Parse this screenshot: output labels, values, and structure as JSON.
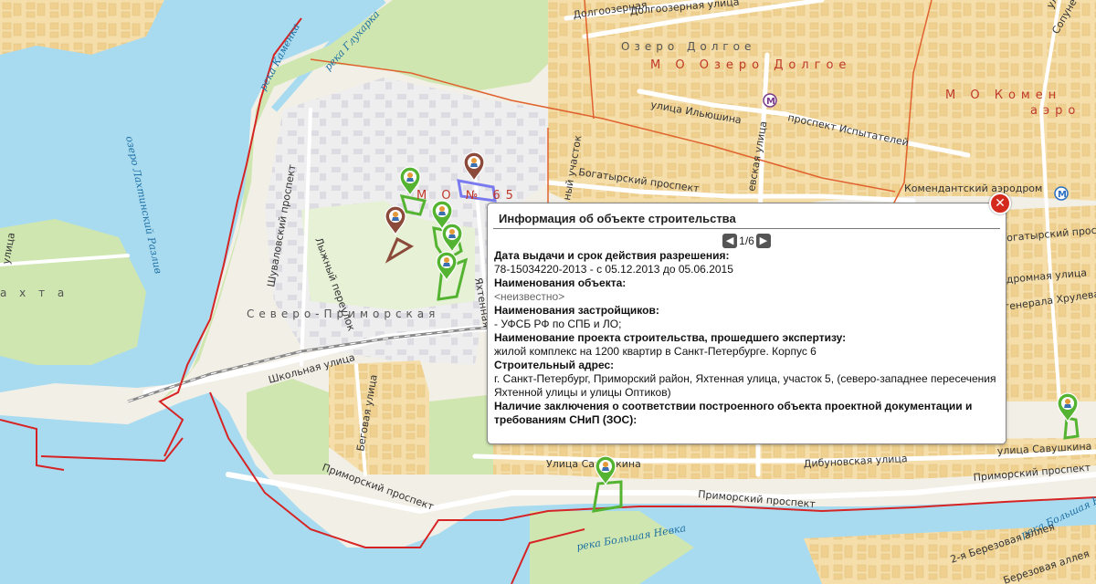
{
  "popup": {
    "title": "Информация об объекте строительства",
    "pager": "1/6",
    "prev_icon": "chevron-left-icon",
    "next_icon": "chevron-right-icon",
    "close_icon": "close-icon",
    "fields": [
      {
        "label": "Дата выдачи и срок действия разрешения:",
        "value": "78-15034220-2013 - с 05.12.2013 до 05.06.2015"
      },
      {
        "label": "Наименования объекта:",
        "value": "<неизвестно>"
      },
      {
        "label": "Наименования застройщиков:",
        "value": "- УФСБ РФ по СПБ и ЛО;"
      },
      {
        "label": "Наименование проекта строительства, прошедшего экспертизу:",
        "value": "жилой комплекс на 1200 квартир в Санкт-Петербурге. Корпус 6"
      },
      {
        "label": "Строительный адрес:",
        "value": "г. Санкт-Петербург, Приморский район, Яхтенная улица, участок 5, (северо-западнее пересечения Яхтенной улицы и улицы Оптиков)"
      },
      {
        "label": "Наличие заключения о соответствии построенного объекта проектной документации и требованиям СНиП (ЗОС):",
        "value": ""
      }
    ]
  },
  "map_labels": {
    "dolgoozernaya_1": "Долгоозерная",
    "dolgoozernaya_2": "Долгоозерная улица",
    "ozero_dolgoe": "Озеро Долгое",
    "mo_ozero_dolgoe": "М О  Озеро Долгое",
    "mo_komendantsky": "М О  Комен",
    "aero": "аэро",
    "ilyushina": "улица Ильюшина",
    "ispytateley": "проспект Испытателей",
    "bogatyrsky_1": "Богатырский проспект",
    "bogatyrsky_2": "Богатырский проспект",
    "komendantsky_aero": "Комендантский аэродром",
    "shuvalovsky": "Шуваловский проспект",
    "lyzhny": "Лыжный переулок",
    "yakhtennaya": "Яхтенная",
    "mo65": "М О  № 65",
    "uchastok": "ный участок",
    "glevskaya": "евская улица",
    "severo_primorskaya": "Северо-Приморская",
    "shkolnaya": "Школьная улица",
    "begovaya": "Беговая улица",
    "primorsky_1": "Приморский проспект",
    "primorsky_2": "Приморский проспект",
    "primorsky_3": "Приморский проспект",
    "savushkina_1": "Улица Савушкина",
    "savushkina_2": "улица Савушкина",
    "dibunovskaya": "Дибуновская улица",
    "aerodromnaya": "дромная улица",
    "khrulyova": "генерала Хрулева",
    "ulitsa_left": "улица",
    "lakhta": "а х т а",
    "reka_kamenka": "река Каменка",
    "reka_glukharka": "река Глухарка",
    "lakhtinsky_razliv": "озеро Лахтинский Разлив",
    "reka_bolshaya_nevka": "река Большая Невка",
    "reka_bolshaya_nevka_2": "река Большая Невка",
    "berezovaya_1": "2-я Березовая аллея",
    "berezovaya_2": "Березовая аллея",
    "solnechnaya": "Сопуне",
    "ulitsa_top": "улица"
  },
  "colors": {
    "water": "#a9dbf0",
    "park": "#cfe6b0",
    "residential": "#f5deaa",
    "industrial": "#e4e4ea",
    "admin_boundary": "#e0622e",
    "district_boundary": "#d62424",
    "object_green": "#54b431",
    "object_brown": "#8b4a3a",
    "object_violet": "#7b7bf0"
  },
  "markers": [
    {
      "name": "construction-marker",
      "icon": "worker-pin-icon",
      "color": "green"
    },
    {
      "name": "construction-marker",
      "icon": "worker-pin-icon",
      "color": "brown"
    },
    {
      "name": "construction-marker",
      "icon": "worker-pin-icon",
      "color": "brown"
    },
    {
      "name": "construction-marker",
      "icon": "worker-pin-icon",
      "color": "green"
    },
    {
      "name": "construction-marker",
      "icon": "worker-pin-icon",
      "color": "green"
    },
    {
      "name": "construction-marker",
      "icon": "worker-pin-icon",
      "color": "green"
    },
    {
      "name": "construction-marker",
      "icon": "worker-pin-icon",
      "color": "green"
    },
    {
      "name": "construction-marker",
      "icon": "worker-pin-icon",
      "color": "green"
    }
  ],
  "metro_icon": "metro-icon"
}
